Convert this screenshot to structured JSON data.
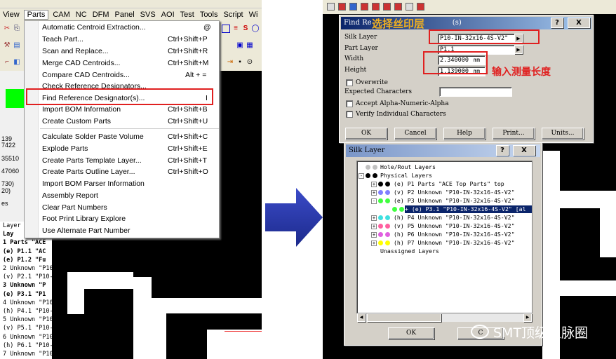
{
  "left_menu_bar": [
    "View",
    "Parts",
    "CAM",
    "NC",
    "DFM",
    "Panel",
    "SVS",
    "AOI",
    "Test",
    "Tools",
    "Script",
    "Wi"
  ],
  "parts_menu": [
    {
      "label": "Automatic Centroid Extraction...",
      "shortcut": "@"
    },
    {
      "label": "Teach Part...",
      "shortcut": "Ctrl+Shift+P"
    },
    {
      "label": "Scan and Replace...",
      "shortcut": "Ctrl+Shift+R"
    },
    {
      "label": "Merge CAD Centroids...",
      "shortcut": "Ctrl+Shift+M"
    },
    {
      "label": "Compare CAD Centroids...",
      "shortcut": "Alt + ="
    },
    {
      "label": "Check Reference Designators...",
      "shortcut": ""
    },
    {
      "label": "Find Reference Designator(s)...",
      "shortcut": "I"
    },
    {
      "label": "Import BOM Information",
      "shortcut": "Ctrl+Shift+B"
    },
    {
      "label": "Create Custom Parts",
      "shortcut": "Ctrl+Shift+U"
    },
    {
      "label": "Calculate Solder Paste Volume",
      "shortcut": "Ctrl+Shift+C"
    },
    {
      "label": "Explode Parts",
      "shortcut": "Ctrl+Shift+E"
    },
    {
      "label": "Create Parts Template Layer...",
      "shortcut": "Ctrl+Shift+T"
    },
    {
      "label": "Create Parts Outline Layer...",
      "shortcut": "Ctrl+Shift+O"
    },
    {
      "label": "Import BOM Parser Information",
      "shortcut": ""
    },
    {
      "label": "Assembly Report",
      "shortcut": ""
    },
    {
      "label": "Clear Part Numbers",
      "shortcut": ""
    },
    {
      "label": "Foot Print Library Explore",
      "shortcut": ""
    },
    {
      "label": "Use Alternate Part Number",
      "shortcut": ""
    }
  ],
  "left_panel_values": [
    "139",
    "7422",
    "35510",
    "47060",
    "730)",
    "20)",
    "es"
  ],
  "left_layer_list": [
    "Layer",
    "Lay",
    "1 Parts \"ACE",
    "(e) P1.1 \"AC",
    "(e) P1.2 \"Fu",
    "2 Unknown \"P10-",
    "(v) P2.1 \"P10-",
    "3 Unknown \"P",
    "(e) P3.1 \"P1",
    "4 Unknown \"P10-",
    "(h) P4.1 \"P10-",
    "5 Unknown \"P10-",
    "(v) P5.1 \"P10-",
    "6 Unknown \"P10-",
    "(h) P6.1 \"P10-",
    "7 Unknown \"P10-"
  ],
  "find_dialog": {
    "title": "Find Re",
    "title_suffix": "(s)",
    "help_btn": "?",
    "close_btn": "X",
    "annotation_top": "选择丝印层",
    "annotation_measure": "输入测量长度",
    "silk_layer_label": "Silk Layer",
    "silk_layer_value": "P10-IN-32x16-4S-V2\"",
    "part_layer_label": "Part Layer",
    "part_layer_value": "P1.1",
    "width_label": "Width",
    "width_value": "2.340000",
    "width_unit": "mm",
    "height_label": "Height",
    "height_value": "1.139000",
    "height_unit": "mm",
    "overwrite_label": "Overwrite",
    "expected_label": "Expected Characters",
    "expected_value": "",
    "accept_label": "Accept Alpha-Numeric-Alpha",
    "verify_label": "Verify Individual Characters",
    "buttons": [
      "OK",
      "Cancel",
      "Help",
      "Print...",
      "Units..."
    ]
  },
  "silk_dialog": {
    "title": "Silk Layer",
    "help_btn": "?",
    "close_btn": "X",
    "tree": [
      {
        "text": "Hole/Rout Layers",
        "color": "#c0c0c0",
        "sign": ""
      },
      {
        "text": "Physical Layers",
        "color": "#000000",
        "sign": "-"
      },
      {
        "text": "(e) P1 Parts \"ACE Top Parts\" top",
        "color": "#000000",
        "sign": "+"
      },
      {
        "text": "(v) P2 Unknown \"P10-IN-32x16-4S-V2\"",
        "color": "#8080ff",
        "sign": "+"
      },
      {
        "text": "(e) P3 Unknown \"P10-IN-32x16-4S-V2\"",
        "color": "#40ff40",
        "sign": "-"
      },
      {
        "text": "+ (e) P3.1 \"P10-IN-32x16-4S-V2\" [al",
        "color": "#40ff40",
        "sign": "",
        "selected": true
      },
      {
        "text": "(h) P4 Unknown \"P10-IN-32x16-4S-V2\"",
        "color": "#40e0e0",
        "sign": "+"
      },
      {
        "text": "(v) P5 Unknown \"P10-IN-32x16-4S-V2\"",
        "color": "#ff60a0",
        "sign": "+"
      },
      {
        "text": "(h) P6 Unknown \"P10-IN-32x16-4S-V2\"",
        "color": "#e060e0",
        "sign": "+"
      },
      {
        "text": "(h) P7 Unknown \"P10-IN-32x16-4S-V2\"",
        "color": "#ffff00",
        "sign": "+"
      },
      {
        "text": "Unassigned Layers",
        "color": "",
        "sign": ""
      }
    ],
    "ok_btn": "OK",
    "cancel_btn": "C"
  },
  "watermark": "SMT顶级人脉圈"
}
